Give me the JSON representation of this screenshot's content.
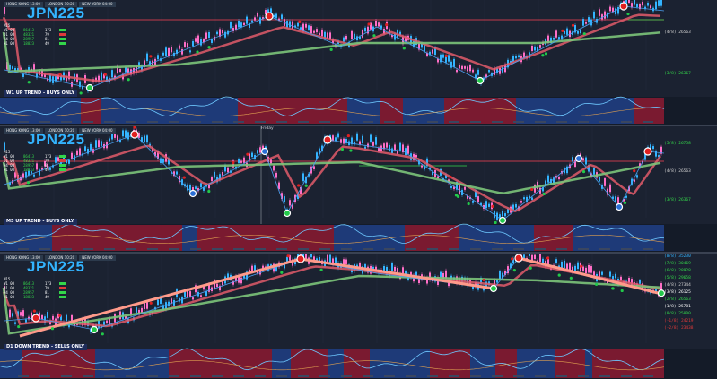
{
  "symbol": "JPN225",
  "sessions": [
    "HONG KONG 13:00",
    "LONDON 10:20",
    "NEW YORK 04:00"
  ],
  "panels": [
    {
      "id": "w1",
      "indicator_label": "W1  UP TREND - BUYS ONLY",
      "table": [
        {
          "label": "M15",
          "v1": "",
          "v2": ""
        },
        {
          "label": "W1 00",
          "v1": "86413",
          "v2": "173"
        },
        {
          "label": "D1 00",
          "v1": "48321",
          "v2": "79"
        },
        {
          "label": "H4 00",
          "v1": "28957",
          "v2": "81"
        },
        {
          "label": "H1 00",
          "v1": "18823",
          "v2": "49"
        }
      ],
      "levels": [
        {
          "label": "(4/8) 26563",
          "color": "#d0d0d0"
        },
        {
          "label": "(3/8) 26367",
          "color": "#33d64a"
        }
      ]
    },
    {
      "id": "m5",
      "indicator_label": "M5  UP TREND - BUYS ONLY",
      "friday_label": "Friday",
      "table": [
        {
          "label": "M15",
          "v1": "",
          "v2": ""
        },
        {
          "label": "W1 00",
          "v1": "86413",
          "v2": "173"
        },
        {
          "label": "D1 00",
          "v1": "48321",
          "v2": "79"
        },
        {
          "label": "H4 00",
          "v1": "28957",
          "v2": "81"
        },
        {
          "label": "H1 00",
          "v1": "18823",
          "v2": "49"
        }
      ],
      "levels": [
        {
          "label": "(5/8) 26758",
          "color": "#33d64a"
        },
        {
          "label": "(4/8) 26563",
          "color": "#d0d0d0"
        },
        {
          "label": "(3/8) 26367",
          "color": "#33d64a"
        }
      ]
    },
    {
      "id": "d1",
      "indicator_label": "D1  DOWN TREND - SELLS ONLY",
      "table": [
        {
          "label": "M15",
          "v1": "",
          "v2": ""
        },
        {
          "label": "W1 00",
          "v1": "86413",
          "v2": "173"
        },
        {
          "label": "D1 00",
          "v1": "48321",
          "v2": "79"
        },
        {
          "label": "H4 00",
          "v1": "28957",
          "v2": "81"
        },
        {
          "label": "H1 00",
          "v1": "18823",
          "v2": "49"
        }
      ],
      "levels": [
        {
          "label": "(8/8) 35230",
          "color": "#33b4ff"
        },
        {
          "label": "(7/8) 30469",
          "color": "#33d64a"
        },
        {
          "label": "(6/8) 28928",
          "color": "#33d64a"
        },
        {
          "label": "(5/8) 29658",
          "color": "#33d64a"
        },
        {
          "label": "(4/8) 27344",
          "color": "#d0d0d0"
        },
        {
          "label": "(3/8) 26125",
          "color": "#ffffff"
        },
        {
          "label": "(2/8) 26563",
          "color": "#33d64a"
        },
        {
          "label": "(1/8) 25781",
          "color": "#ffffff"
        },
        {
          "label": "(0/8) 25000",
          "color": "#33d64a"
        },
        {
          "label": "(-1/8) 24219",
          "color": "#e03a3a"
        },
        {
          "label": "(-2/8) 23438",
          "color": "#e03a3a"
        }
      ]
    }
  ],
  "colors": {
    "background": "#1b2231",
    "bull_candle": "#33b4ff",
    "bear_candle": "#ff6ec7",
    "ma_fast": "#e05a6a",
    "ma_slow": "#7cc47a",
    "zigzag": "#4a9ff0",
    "trend_line": "#ff4d2e",
    "indicator_red": "#7a1a30",
    "indicator_blue": "#1e3a78",
    "swing_high": "#e02020",
    "swing_low": "#22c94a"
  }
}
